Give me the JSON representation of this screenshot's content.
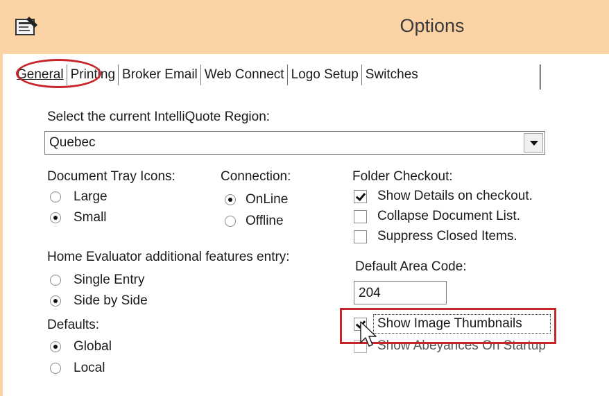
{
  "window": {
    "title": "Options",
    "icon": "properties-window-icon"
  },
  "tabs": [
    {
      "label": "General",
      "selected": true
    },
    {
      "label": "Printing"
    },
    {
      "label": "Broker Email"
    },
    {
      "label": "Web Connect"
    },
    {
      "label": "Logo Setup"
    },
    {
      "label": "Switches"
    }
  ],
  "region": {
    "label": "Select the current IntelliQuote Region:",
    "value": "Quebec"
  },
  "tray_icons": {
    "label": "Document Tray Icons:",
    "options": [
      {
        "label": "Large",
        "checked": false
      },
      {
        "label": "Small",
        "checked": true
      }
    ]
  },
  "connection": {
    "label": "Connection:",
    "options": [
      {
        "label": "OnLine",
        "checked": true
      },
      {
        "label": "Offline",
        "checked": false
      }
    ]
  },
  "folder_checkout": {
    "label": "Folder Checkout:",
    "options": [
      {
        "label": "Show Details on checkout.",
        "checked": true
      },
      {
        "label": "Collapse Document List.",
        "checked": false
      },
      {
        "label": "Suppress Closed Items.",
        "checked": false
      }
    ]
  },
  "home_evaluator": {
    "label": "Home Evaluator additional features entry:",
    "options": [
      {
        "label": "Single Entry",
        "checked": false
      },
      {
        "label": "Side by Side",
        "checked": true
      }
    ]
  },
  "defaults": {
    "label": "Defaults:",
    "options": [
      {
        "label": "Global",
        "checked": true
      },
      {
        "label": "Local",
        "checked": false
      }
    ]
  },
  "area_code": {
    "label": "Default Area Code:",
    "value": "204"
  },
  "extras": [
    {
      "label": "Show Image Thumbnails",
      "checked": true
    },
    {
      "label": "Show Abeyances On Startup",
      "checked": false
    }
  ],
  "colors": {
    "titlebar": "#fbd3a4",
    "annotation": "#c8242a"
  }
}
